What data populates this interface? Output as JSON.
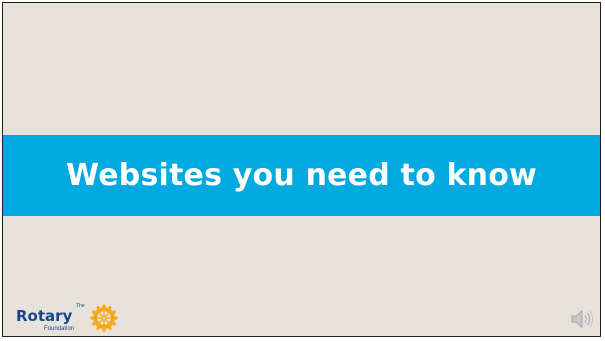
{
  "slide": {
    "title": "Websites you need to know"
  },
  "logo": {
    "the": "The",
    "brand": "Rotary",
    "foundation": "Foundation"
  },
  "icons": {
    "wheel": "rotary-wheel-icon",
    "audio": "speaker-icon"
  },
  "colors": {
    "background": "#e7e3da",
    "band": "#00a9e0",
    "title_text": "#ffffff",
    "brand_blue": "#17458f",
    "wheel_gold": "#f7a81b"
  }
}
